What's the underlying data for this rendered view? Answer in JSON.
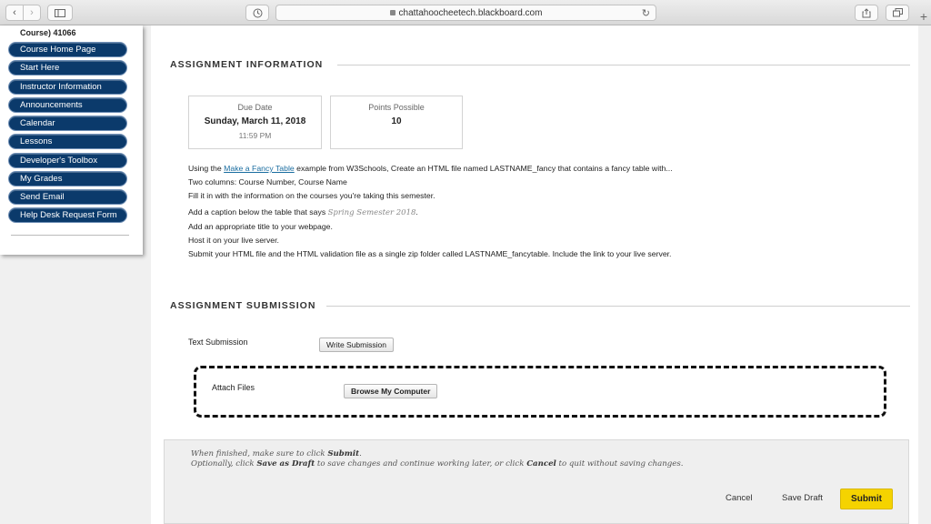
{
  "browser": {
    "url": "chattahoocheetech.blackboard.com"
  },
  "course_menu": {
    "title": "Course) 41066",
    "items": [
      {
        "label": "Course Home Page"
      },
      {
        "label": "Start Here"
      },
      {
        "label": "Instructor Information"
      },
      {
        "label": "Announcements"
      },
      {
        "label": "Calendar"
      },
      {
        "label": "Lessons"
      },
      {
        "label": "Developer's Toolbox"
      },
      {
        "label": "My Grades"
      },
      {
        "label": "Send Email"
      },
      {
        "label": "Help Desk Request Form"
      }
    ]
  },
  "assignment_info": {
    "heading": "ASSIGNMENT INFORMATION",
    "due": {
      "label": "Due Date",
      "date": "Sunday, March 11, 2018",
      "time": "11:59 PM"
    },
    "points": {
      "label": "Points Possible",
      "value": "10"
    },
    "instructions": {
      "line1_pre": "Using the ",
      "line1_link": "Make a Fancy Table",
      "line1_post": " example from W3Schools, Create an HTML file named LASTNAME_fancy that contains a fancy table with...",
      "line2": "Two columns: Course Number, Course Name",
      "line3": "Fill it in with the information on the courses you're taking this semester.",
      "line4_pre": "Add a caption below the table that says ",
      "line4_italic": "Spring Semester 2018",
      "line4_post": ".",
      "line5": "Add an appropriate title to your webpage.",
      "line6": "Host it on your live server.",
      "line7": "Submit your HTML file and the HTML validation file as a single zip folder called LASTNAME_fancytable. Include the link to your live server."
    }
  },
  "assignment_submission": {
    "heading": "ASSIGNMENT SUBMISSION",
    "text_submission_label": "Text Submission",
    "write_submission_button": "Write Submission",
    "attach_files_label": "Attach Files",
    "browse_button": "Browse My Computer"
  },
  "footer": {
    "note1_pre": "When finished, make sure to click ",
    "note1_bold": "Submit",
    "note1_post": ".",
    "note2_pre": "Optionally, click ",
    "note2_bold1": "Save as Draft",
    "note2_mid": " to save changes and continue working later, or click ",
    "note2_bold2": "Cancel",
    "note2_post": " to quit without saving changes.",
    "cancel": "Cancel",
    "save_draft": "Save Draft",
    "submit": "Submit"
  },
  "colors": {
    "menu_button": "#0b3a6b",
    "submit_button": "#f5d300",
    "link": "#1a6da0"
  }
}
